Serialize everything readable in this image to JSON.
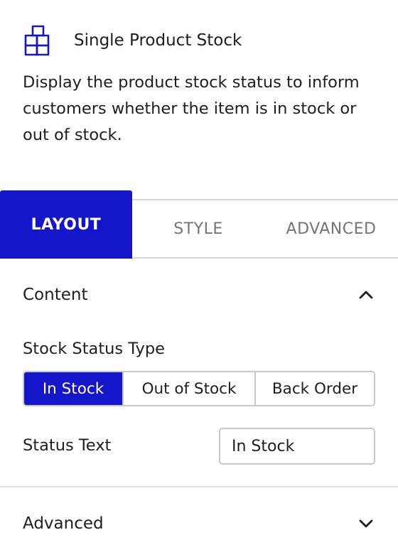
{
  "block": {
    "title": "Single Product Stock",
    "description": "Display the product stock status to inform customers whether the item is in stock or out of stock.",
    "icon": "boxes-icon",
    "accent_color": "#1515c9"
  },
  "tabs": [
    {
      "label": "LAYOUT",
      "active": true
    },
    {
      "label": "STYLE",
      "active": false
    },
    {
      "label": "ADVANCED",
      "active": false
    }
  ],
  "content_panel": {
    "title": "Content",
    "expanded": true,
    "stock_status_type": {
      "label": "Stock Status Type",
      "options": [
        "In Stock",
        "Out of Stock",
        "Back Order"
      ],
      "selected": "In Stock"
    },
    "status_text": {
      "label": "Status Text",
      "value": "In Stock"
    }
  },
  "advanced_panel": {
    "title": "Advanced",
    "expanded": false
  }
}
